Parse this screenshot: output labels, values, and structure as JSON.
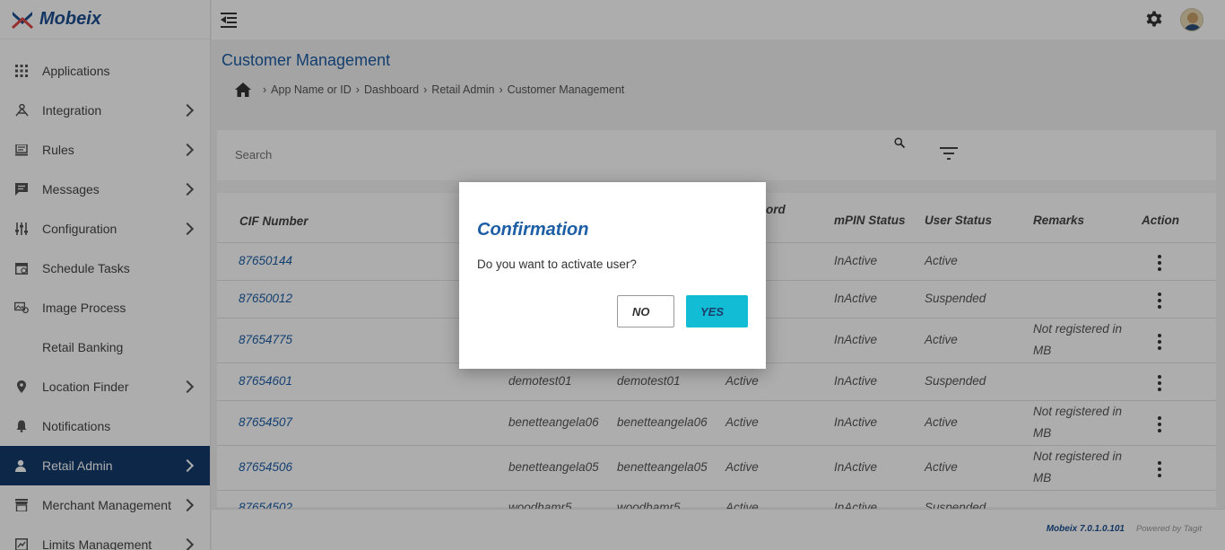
{
  "app": {
    "brand": "Mobeix"
  },
  "sidebar": {
    "items": [
      {
        "label": "Applications",
        "icon": "grid-icon",
        "chevron": false
      },
      {
        "label": "Integration",
        "icon": "integration-icon",
        "chevron": true
      },
      {
        "label": "Rules",
        "icon": "rules-icon",
        "chevron": true
      },
      {
        "label": "Messages",
        "icon": "message-icon",
        "chevron": true
      },
      {
        "label": "Configuration",
        "icon": "sliders-icon",
        "chevron": true
      },
      {
        "label": "Schedule Tasks",
        "icon": "calendar-icon",
        "chevron": false
      },
      {
        "label": "Image Process",
        "icon": "image-process-icon",
        "chevron": false
      },
      {
        "label": "Retail Banking",
        "icon": "",
        "chevron": false
      },
      {
        "label": "Location Finder",
        "icon": "pin-icon",
        "chevron": true
      },
      {
        "label": "Notifications",
        "icon": "bell-icon",
        "chevron": false
      },
      {
        "label": "Retail Admin",
        "icon": "user-icon",
        "chevron": true,
        "active": true
      },
      {
        "label": "Merchant Management",
        "icon": "store-icon",
        "chevron": true
      },
      {
        "label": "Limits Management",
        "icon": "limits-icon",
        "chevron": true
      }
    ]
  },
  "page": {
    "title": "Customer Management",
    "breadcrumb": [
      "App Name or ID",
      "Dashboard",
      "Retail Admin",
      "Customer Management"
    ]
  },
  "search": {
    "placeholder": "Search"
  },
  "table": {
    "headers": {
      "cif": "CIF Number",
      "password_partial": "ord",
      "mpin": "mPIN Status",
      "user_status": "User Status",
      "remarks": "Remarks",
      "action": "Action"
    },
    "rows": [
      {
        "cif": "87650144",
        "user_id": "",
        "name": "",
        "pwd": "",
        "mpin": "InActive",
        "status": "Active",
        "remarks": [
          "",
          ""
        ]
      },
      {
        "cif": "87650012",
        "user_id": "",
        "name": "",
        "pwd": "",
        "mpin": "InActive",
        "status": "Suspended",
        "remarks": [
          "",
          ""
        ]
      },
      {
        "cif": "87654775",
        "user_id": "",
        "name": "",
        "pwd": "",
        "mpin": "InActive",
        "status": "Active",
        "remarks": [
          "Not registered in",
          "MB"
        ]
      },
      {
        "cif": "87654601",
        "user_id": "demotest01",
        "name": "demotest01",
        "pwd": "Active",
        "mpin": "InActive",
        "status": "Suspended",
        "remarks": [
          "",
          ""
        ]
      },
      {
        "cif": "87654507",
        "user_id": "benetteangela06",
        "name": "benetteangela06",
        "pwd": "Active",
        "mpin": "InActive",
        "status": "Active",
        "remarks": [
          "Not registered in",
          "MB"
        ]
      },
      {
        "cif": "87654506",
        "user_id": "benetteangela05",
        "name": "benetteangela05",
        "pwd": "Active",
        "mpin": "InActive",
        "status": "Active",
        "remarks": [
          "Not registered in",
          "MB"
        ]
      },
      {
        "cif": "87654502",
        "user_id": "woodhamr5",
        "name": "woodhamr5",
        "pwd": "Active",
        "mpin": "InActive",
        "status": "Suspended",
        "remarks": [
          "",
          ""
        ]
      }
    ]
  },
  "footer": {
    "version": "Mobeix 7.0.1.0.101",
    "powered": "Powered by Tagit"
  },
  "dialog": {
    "title": "Confirmation",
    "message": "Do you want to activate user?",
    "no_label": "NO",
    "yes_label": "YES"
  },
  "colors": {
    "primary": "#1d5ea5",
    "sidebar_active": "#123a6b",
    "yes_button": "#11bcd4"
  }
}
